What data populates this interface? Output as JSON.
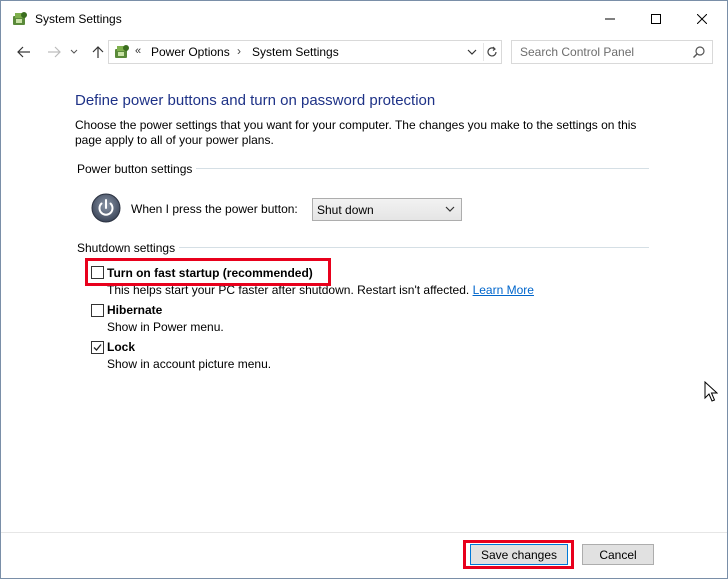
{
  "window": {
    "title": "System Settings",
    "icon": "control-panel-icon"
  },
  "nav": {
    "breadcrumb_sep1": "«",
    "breadcrumb": [
      "Power Options",
      "System Settings"
    ],
    "breadcrumb_sep2": "›",
    "search_placeholder": "Search Control Panel"
  },
  "main": {
    "title": "Define power buttons and turn on password protection",
    "description": "Choose the power settings that you want for your computer. The changes you make to the settings on this page apply to all of your power plans.",
    "power_group_label": "Power button settings",
    "power_button_label": "When I press the power button:",
    "power_button_value": "Shut down",
    "shutdown_group_label": "Shutdown settings",
    "options": [
      {
        "title": "Turn on fast startup (recommended)",
        "desc": "This helps start your PC faster after shutdown. Restart isn't affected.",
        "link": "Learn More",
        "checked": false
      },
      {
        "title": "Hibernate",
        "desc": "Show in Power menu.",
        "checked": false
      },
      {
        "title": "Lock",
        "desc": "Show in account picture menu.",
        "checked": true
      }
    ]
  },
  "footer": {
    "save_label": "Save changes",
    "cancel_label": "Cancel"
  },
  "colors": {
    "title_blue": "#1e3287",
    "link_blue": "#0066cc",
    "highlight_red": "#e8001c"
  }
}
